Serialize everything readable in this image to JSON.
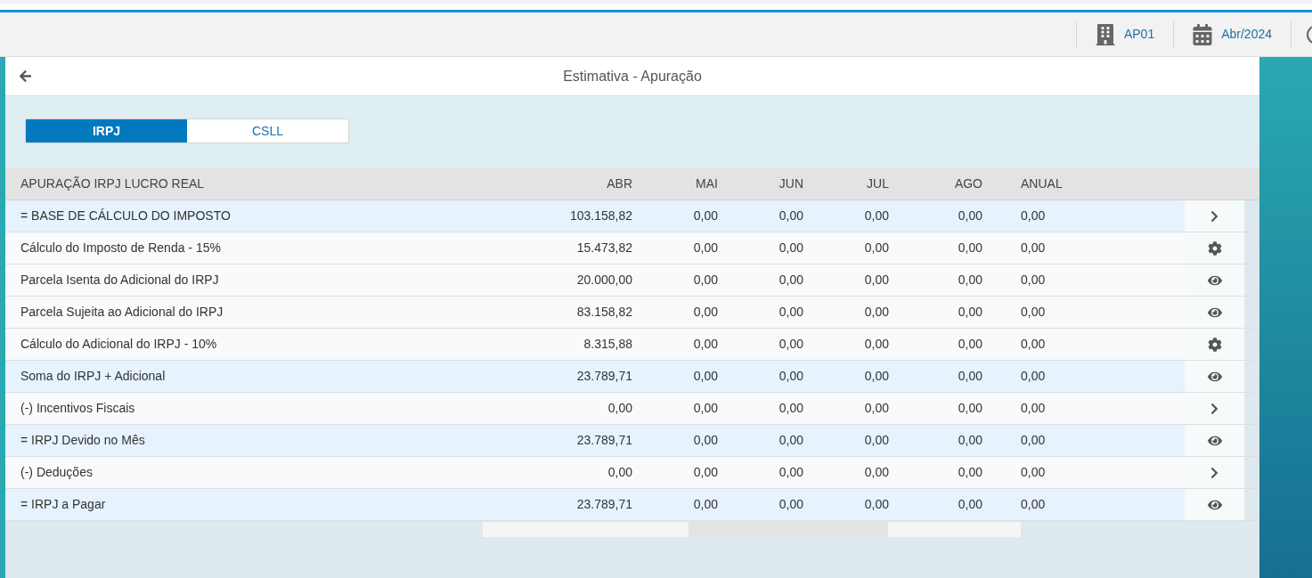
{
  "topbar": {
    "company": "AP01",
    "period": "Abr/2024"
  },
  "header": {
    "title": "Estimativa - Apuração"
  },
  "tabs": [
    {
      "label": "IRPJ",
      "selected": true
    },
    {
      "label": "CSLL",
      "selected": false
    }
  ],
  "table": {
    "columns": [
      "APURAÇÃO IRPJ LUCRO REAL",
      "ABR",
      "MAI",
      "JUN",
      "JUL",
      "AGO",
      "ANUAL"
    ],
    "rows": [
      {
        "label": "= BASE DE CÁLCULO DO IMPOSTO",
        "values": [
          "103.158,82",
          "0,00",
          "0,00",
          "0,00",
          "0,00",
          "0,00"
        ],
        "highlighted": true,
        "kind": "chevron"
      },
      {
        "label": "Cálculo do Imposto de Renda - 15%",
        "values": [
          "15.473,82",
          "0,00",
          "0,00",
          "0,00",
          "0,00",
          "0,00"
        ],
        "highlighted": false,
        "kind": "gear"
      },
      {
        "label": "Parcela Isenta do Adicional do IRPJ",
        "values": [
          "20.000,00",
          "0,00",
          "0,00",
          "0,00",
          "0,00",
          "0,00"
        ],
        "highlighted": false,
        "kind": "eye"
      },
      {
        "label": "Parcela Sujeita ao Adicional do IRPJ",
        "values": [
          "83.158,82",
          "0,00",
          "0,00",
          "0,00",
          "0,00",
          "0,00"
        ],
        "highlighted": false,
        "kind": "eye"
      },
      {
        "label": "Cálculo do Adicional do IRPJ - 10%",
        "values": [
          "8.315,88",
          "0,00",
          "0,00",
          "0,00",
          "0,00",
          "0,00"
        ],
        "highlighted": false,
        "kind": "gear"
      },
      {
        "label": "Soma do IRPJ + Adicional",
        "values": [
          "23.789,71",
          "0,00",
          "0,00",
          "0,00",
          "0,00",
          "0,00"
        ],
        "highlighted": true,
        "kind": "eye"
      },
      {
        "label": "(-) Incentivos Fiscais",
        "values": [
          "0,00",
          "0,00",
          "0,00",
          "0,00",
          "0,00",
          "0,00"
        ],
        "highlighted": false,
        "kind": "chevron"
      },
      {
        "label": "= IRPJ Devido no Mês",
        "values": [
          "23.789,71",
          "0,00",
          "0,00",
          "0,00",
          "0,00",
          "0,00"
        ],
        "highlighted": true,
        "kind": "eye"
      },
      {
        "label": "(-) Deduções",
        "values": [
          "0,00",
          "0,00",
          "0,00",
          "0,00",
          "0,00",
          "0,00"
        ],
        "highlighted": false,
        "kind": "chevron"
      },
      {
        "label": "= IRPJ a Pagar",
        "values": [
          "23.789,71",
          "0,00",
          "0,00",
          "0,00",
          "0,00",
          "0,00"
        ],
        "highlighted": true,
        "kind": "eye"
      }
    ]
  }
}
